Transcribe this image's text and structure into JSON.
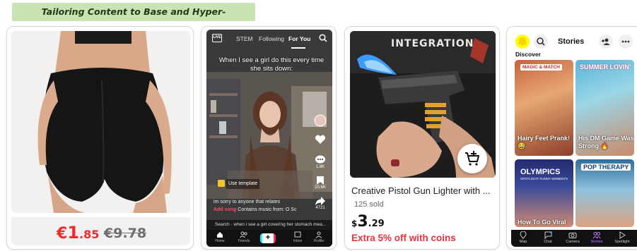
{
  "banner": {
    "text": "Tailoring Content to Base and Hyper-Personalized Pleasures"
  },
  "product1": {
    "price_currency": "€",
    "price_int": "1",
    "price_dec": ".85",
    "old_price": "€9.78"
  },
  "video": {
    "tabs": [
      "STEM",
      "Following",
      "For You"
    ],
    "live_label": "LIVE",
    "caption": "When I see a girl do this every time she sits down:",
    "actions": [
      {
        "icon": "heart-icon",
        "count": ""
      },
      {
        "icon": "comment-icon",
        "count": "1.6K"
      },
      {
        "icon": "bookmark-icon",
        "count": "10.6K"
      },
      {
        "icon": "share-icon",
        "count": "4721"
      }
    ],
    "template_label": "Use template",
    "description": "im sorry to anyone that relates",
    "add_song_label": "Add song",
    "add_song_text": "Contains music from: O Sc",
    "search_text": "Search · when i see a girl covering her stomach mea...",
    "nav": [
      "Home",
      "Friends",
      "+",
      "Inbox",
      "Profile"
    ]
  },
  "product3": {
    "image_text": "INTEGRATION",
    "title": "Creative Pistol Gun Lighter with ...",
    "sold": "125 sold",
    "price_currency": "$",
    "price_int": "3",
    "price_dec": ".29",
    "promo": "Extra 5% off with coins"
  },
  "stories": {
    "title": "Stories",
    "discover_label": "Discover",
    "tiles": [
      {
        "tag": "MAGIC & MATCH",
        "caption": "Hairy Feet Prank! 😂"
      },
      {
        "tag": "SUMMER LOVIN'",
        "caption": "His DM Game Was Strong 🔥"
      },
      {
        "tag": "OLYMPICS",
        "subtag": "SPOTLIGHT: FUNNY MOMENTS",
        "caption": "How To Go Viral"
      },
      {
        "tag": "POP THERAPY",
        "caption": ""
      }
    ],
    "nav": [
      "Map",
      "Chat",
      "Camera",
      "Stories",
      "Spotlight"
    ],
    "colors": {
      "brand_yellow": "#fffc00",
      "active_nav": "#c478ff"
    }
  },
  "colors": {
    "banner_bg": "#c9e4b3",
    "sale_red": "#ee2a2a",
    "promo_red": "#e8323c"
  }
}
